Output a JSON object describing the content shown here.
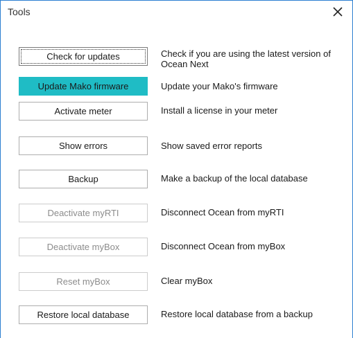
{
  "window": {
    "title": "Tools",
    "close_icon": "close-icon"
  },
  "colors": {
    "accent": "#1fbcc5",
    "window_border": "#2b7fd1"
  },
  "actions": [
    {
      "label": "Check for updates",
      "description": "Check if you are using the latest version of Ocean Next",
      "state": "focused"
    },
    {
      "label": "Update Mako firmware",
      "description": "Update your Mako's firmware",
      "state": "primary"
    },
    {
      "label": "Activate meter",
      "description": "Install a license in your meter",
      "state": "enabled"
    },
    {
      "label": "Show errors",
      "description": "Show saved error reports",
      "state": "enabled"
    },
    {
      "label": "Backup",
      "description": "Make a backup of the local database",
      "state": "enabled"
    },
    {
      "label": "Deactivate myRTI",
      "description": "Disconnect Ocean from myRTI",
      "state": "disabled"
    },
    {
      "label": "Deactivate myBox",
      "description": "Disconnect Ocean from myBox",
      "state": "disabled"
    },
    {
      "label": "Reset myBox",
      "description": "Clear myBox",
      "state": "disabled"
    },
    {
      "label": "Restore local database",
      "description": "Restore local database from a backup",
      "state": "enabled"
    }
  ]
}
